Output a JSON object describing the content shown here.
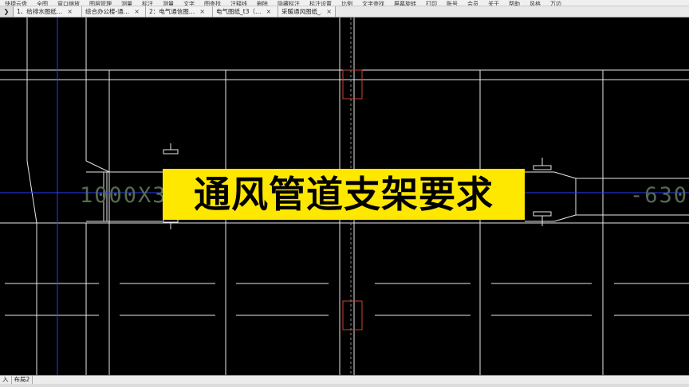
{
  "toolbar": {
    "items": [
      "快捷云盘",
      "全图",
      "窗口缩放",
      "图层管理",
      "测量",
      "标注",
      "测量",
      "文字",
      "图查找",
      "注释线",
      "删除",
      "隐藏标注",
      "标注设置",
      "比例",
      "文字查找",
      "屏幕旋转",
      "打印",
      "账号",
      "会员",
      "关于",
      "帮助",
      "风格",
      "万边"
    ]
  },
  "tabs": {
    "arrow": "❯",
    "items": [
      {
        "label": "1、给排水图纸…"
      },
      {
        "label": "综合办公楼-通…"
      },
      {
        "label": "2：电气通信图…"
      },
      {
        "label": "电气图纸_t3（…"
      },
      {
        "label": "采暖通风图纸_…"
      }
    ],
    "close": "×"
  },
  "drawing": {
    "duct_label_left": "1000X3",
    "duct_label_right": "-630",
    "colors": {
      "white": "#e8e8e8",
      "blue": "#2a3cff",
      "yellow": "#ffe800",
      "red": "#d04030",
      "grey": "#8a8a8a",
      "green": "#556b55"
    }
  },
  "banner": {
    "title": "通风管道支架要求"
  },
  "layout_tabs": [
    "入",
    "布局2"
  ]
}
